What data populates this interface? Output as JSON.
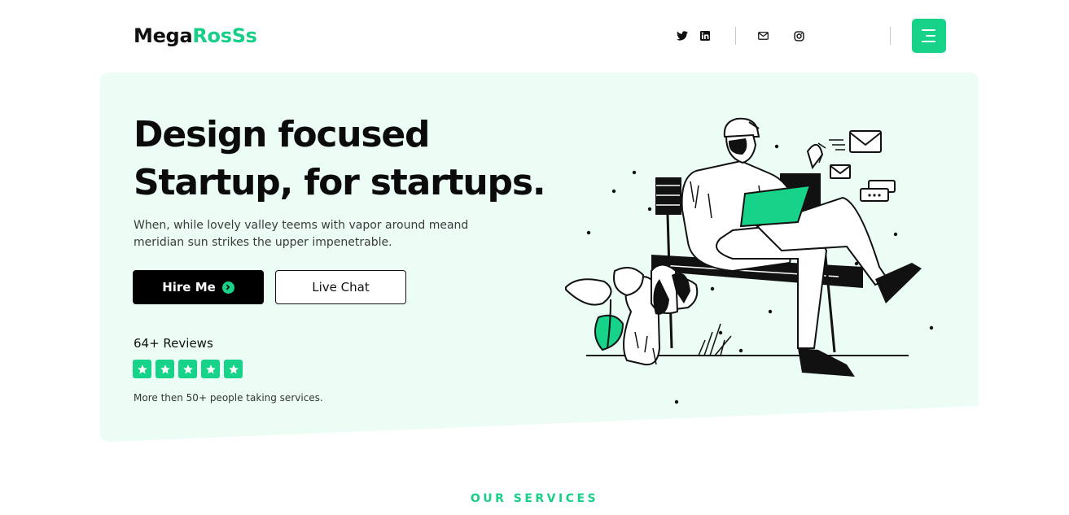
{
  "header": {
    "logo_part1": "Mega",
    "logo_part2": "RosSs",
    "social_icons": [
      "twitter-icon",
      "linkedin-icon",
      "mail-icon",
      "instagram-icon"
    ],
    "menu_icon": "hamburger-menu-icon"
  },
  "hero": {
    "title_line1": "Design focused",
    "title_line2": "Startup, for startups.",
    "description": "When, while lovely valley teems with vapor around meand meridian sun strikes the upper impenetrable.",
    "hire_label": "Hire Me",
    "chat_label": "Live Chat",
    "reviews_count": "64+ Reviews",
    "rating_stars": 5,
    "reviews_note": "More then 50+ people taking services."
  },
  "services": {
    "eyebrow": "OUR SERVICES"
  },
  "colors": {
    "accent": "#17d38a",
    "hero_background": "#ebfdf5",
    "text_dark": "#0b0b0b"
  }
}
